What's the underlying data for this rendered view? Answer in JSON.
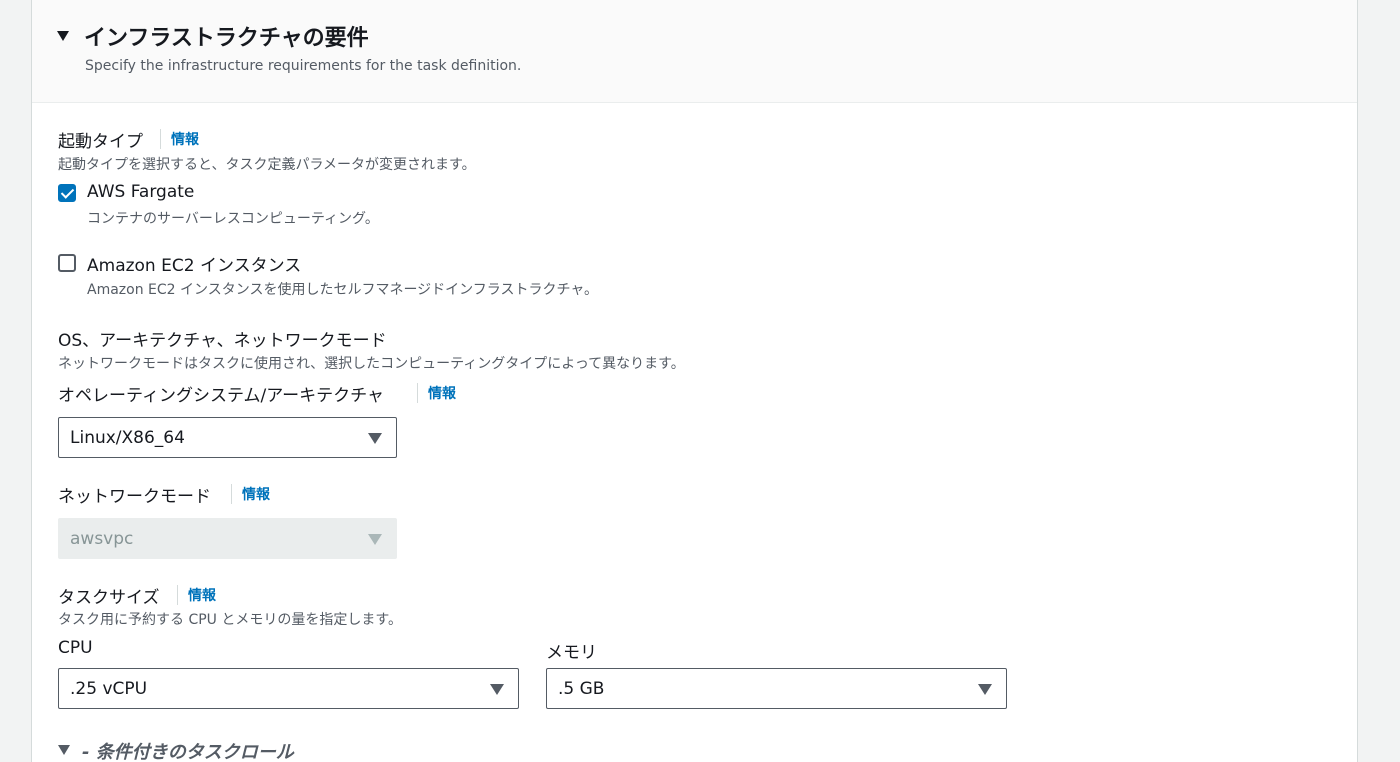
{
  "section": {
    "title": "インフラストラクチャの要件",
    "description": "Specify the infrastructure requirements for the task definition."
  },
  "info_label": "情報",
  "launch_type": {
    "label": "起動タイプ",
    "description": "起動タイプを選択すると、タスク定義パラメータが変更されます。",
    "options": [
      {
        "label": "AWS Fargate",
        "description": "コンテナのサーバーレスコンピューティング。",
        "checked": true
      },
      {
        "label": "Amazon EC2 インスタンス",
        "description": "Amazon EC2 インスタンスを使用したセルフマネージドインフラストラクチャ。",
        "checked": false
      }
    ]
  },
  "os_arch": {
    "group_label": "OS、アーキテクチャ、ネットワークモード",
    "group_description": "ネットワークモードはタスクに使用され、選択したコンピューティングタイプによって異なります。",
    "os_label": "オペレーティングシステム/アーキテクチャ",
    "os_value": "Linux/X86_64",
    "network_label": "ネットワークモード",
    "network_value": "awsvpc"
  },
  "task_size": {
    "label": "タスクサイズ",
    "description": "タスク用に予約する CPU とメモリの量を指定します。",
    "cpu_label": "CPU",
    "cpu_value": ".25 vCPU",
    "memory_label": "メモリ",
    "memory_value": ".5 GB"
  },
  "task_role": {
    "title": "- 条件付きのタスクロール"
  },
  "colors": {
    "accent": "#0073bb",
    "text": "#16191f",
    "secondary_text": "#545b64",
    "page_background": "#f2f3f3"
  }
}
